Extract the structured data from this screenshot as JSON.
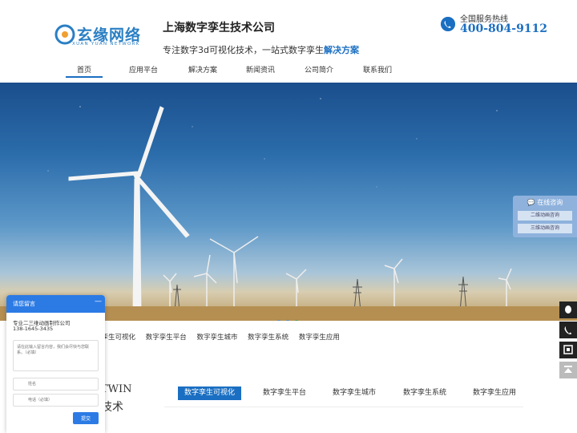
{
  "logo": {
    "name_cn": "玄缘网络",
    "name_en": "XUAN YUAN NETWORK"
  },
  "company": {
    "name": "上海数字孪生技术公司",
    "slogan_prefix": "专注数字3d可视化技术，一站式数字孪生",
    "slogan_highlight": "解决方案"
  },
  "hotline": {
    "label": "全国服务热线",
    "number": "400-804-9112",
    "icon": "phone-icon"
  },
  "nav": {
    "items": [
      "首页",
      "应用平台",
      "解决方案",
      "新闻资讯",
      "公司简介",
      "联系我们"
    ],
    "active_index": 0
  },
  "banner": {
    "slide_count": 3,
    "active_slide": 0
  },
  "sub_tabs": [
    "字孪生可视化",
    "数字孪生平台",
    "数字孪生城市",
    "数字孪生系统",
    "数字孪生应用"
  ],
  "section": {
    "title_en": "TWIN",
    "title_cn": "技术",
    "tabs": [
      "数字孪生可视化",
      "数字孪生平台",
      "数字孪生城市",
      "数字孪生系统",
      "数字孪生应用"
    ],
    "active_tab": 0
  },
  "consult": {
    "title": "在线咨询",
    "buttons": [
      "二维动画咨询",
      "三维动画咨询"
    ]
  },
  "side_icons": [
    "qq-icon",
    "phone-icon",
    "qrcode-icon",
    "back-to-top-icon"
  ],
  "chat": {
    "title": "请您留言",
    "minimize": "—",
    "company": "专业二三维动画制作公司",
    "phone": "138-1645-3435",
    "message_placeholder": "请在此输入留言内容，我们会尽快与您联系。（必填）",
    "name_placeholder": "姓名",
    "phone_placeholder": "电话（必填）",
    "submit": "提交"
  },
  "colors": {
    "brand": "#1b6fc2",
    "chat_header": "#2c7be5"
  }
}
